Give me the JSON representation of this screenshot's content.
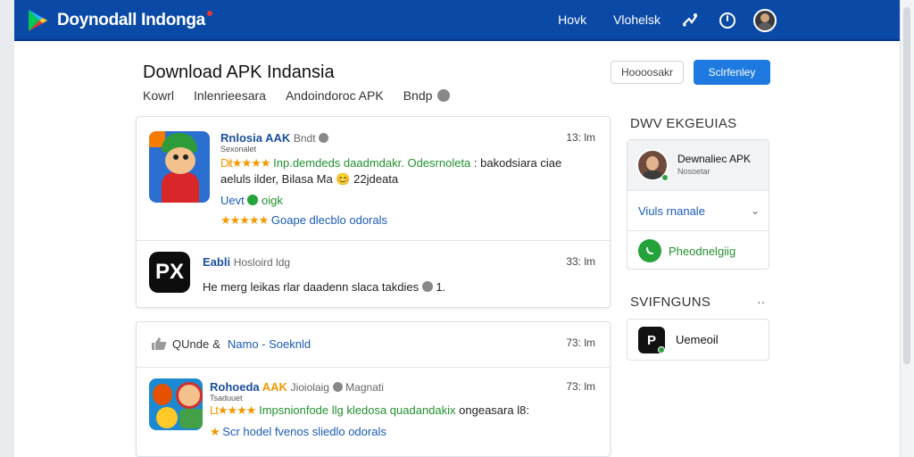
{
  "brand": {
    "name": "Doynodall Indonga"
  },
  "topnav": {
    "items": [
      "Hovk",
      "Vlohelsk"
    ]
  },
  "header": {
    "title": "Download APK Indansia",
    "breadcrumb": [
      "Kowrl",
      "Inlenrieesara",
      "Andoindoroc APK",
      "Bndp"
    ],
    "btn_outline": "Hoooosakr",
    "btn_primary": "Sclrfenley"
  },
  "feed": {
    "post1": {
      "title": "Rnlosia AAK",
      "meta": "Bndt",
      "subline": "Sexonalet",
      "time": "13: lm",
      "rating_prefix": "Dit",
      "stars": "★★★★",
      "desc_green": "Inp.demdeds daadmdakr. Odesrnoleta",
      "desc_rest": ": bakodsiara ciae",
      "line2": "aeluls ilder, Bilasa Ma",
      "emoji": "😊",
      "line2_end": "22jdeata",
      "user_label": "Uevt",
      "user_badge": "oigk",
      "rating2_stars": "★★★★★",
      "rating2_text": "Goape dlecblo odorals"
    },
    "post2": {
      "icon_text": "PX",
      "title": "Eabli",
      "meta": "Hosloird ldg",
      "time": "33: lm",
      "text": "He merg leikas rlar daadenn slaca takdies",
      "text_end": "1."
    },
    "post3": {
      "like_text": "QUnde",
      "like_amp": "&",
      "like_name": "Namo - Soeknld",
      "time": "73: lm"
    },
    "post4": {
      "title_blue": "Rohoeda",
      "title_orange": "AAK",
      "meta": "Jioiolaig",
      "meta2": "Magnati",
      "subline": "Tsaduuet",
      "time": "73: lm",
      "stars": "★★★★",
      "rating_prefix": "Lt",
      "desc_green": "Impsnionfode llg kledosa quadandakix",
      "desc_rest": "ongeasara l8:",
      "rating2_star": "★",
      "rating2_text": "Scr hodel fvenos sliedlo odorals"
    }
  },
  "sidebar": {
    "heading1": "DWV EKGEUIAS",
    "profile_name": "Dewnaliec APK",
    "profile_sub": "Nosoetar",
    "row1": "Viuls rnanale",
    "row2": "Pheodnelgiig",
    "heading2": "SVIFNGUNS",
    "more": "··",
    "s2_icon": "P",
    "s2_label": "Uemeoil"
  },
  "colors": {
    "topbar": "#0a4aa6",
    "primary": "#1e7ae0",
    "link": "#1a5bb5",
    "green": "#23912e",
    "star": "#f29900"
  }
}
